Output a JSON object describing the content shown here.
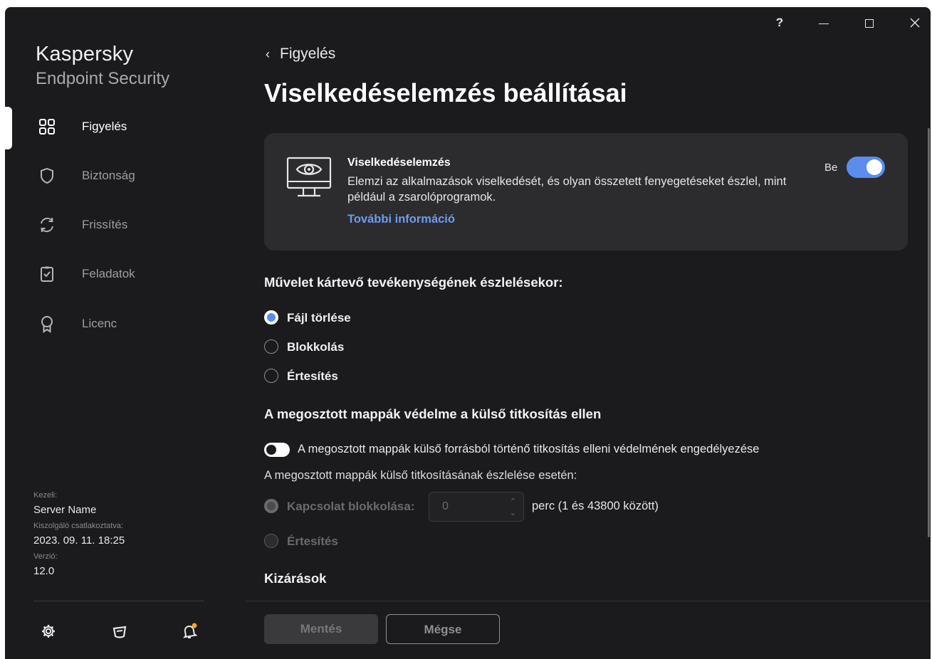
{
  "window": {
    "controls": {
      "help": "?"
    }
  },
  "brand": {
    "line1": "Kaspersky",
    "line2": "Endpoint Security"
  },
  "sidebar": {
    "items": [
      {
        "label": "Figyelés",
        "icon": "grid-icon",
        "active": true
      },
      {
        "label": "Biztonság",
        "icon": "shield-icon",
        "active": false
      },
      {
        "label": "Frissítés",
        "icon": "refresh-icon",
        "active": false
      },
      {
        "label": "Feladatok",
        "icon": "clipboard-check-icon",
        "active": false
      },
      {
        "label": "Licenc",
        "icon": "award-icon",
        "active": false
      }
    ],
    "meta": {
      "managed_label": "Kezeli:",
      "server_name": "Server Name",
      "connected_label": "Kiszolgáló csatlakoztatva:",
      "connected_time": "2023. 09. 11. 18:25",
      "version_label": "Verzió:",
      "version": "12.0"
    },
    "bottom_icons": [
      "gear-icon",
      "support-icon",
      "bell-icon"
    ]
  },
  "main": {
    "back_label": "Figyelés",
    "title": "Viselkedéselemzés beállításai",
    "card": {
      "title": "Viselkedéselemzés",
      "description": "Elemzi az alkalmazások viselkedését, és olyan összetett fenyegetéseket észlel, mint például a zsarolóprogramok.",
      "link": "További információ",
      "toggle_label": "Be",
      "toggle_on": true
    },
    "action_heading": "Művelet kártevő tevékenységének észlelésekor:",
    "action_options": [
      "Fájl törlése",
      "Blokkolás",
      "Értesítés"
    ],
    "action_selected": "Fájl törlése",
    "shared_heading": "A megosztott mappák védelme a külső titkosítás ellen",
    "shared_toggle_label": "A megosztott mappák külső forrásból történő titkosítás elleni védelmének engedélyezése",
    "shared_toggle_on": false,
    "shared_detect_label": "A megosztott mappák külső titkosításának észlelése esetén:",
    "block_label": "Kapcsolat blokkolása:",
    "block_value": "0",
    "block_range": "perc (1 és 43800 között)",
    "notify_label": "Értesítés",
    "exclusions_heading": "Kizárások"
  },
  "footer": {
    "save_label": "Mentés",
    "cancel_label": "Mégse"
  },
  "colors": {
    "accent": "#5a8dee",
    "link": "#6c9cf0",
    "background": "#1b1b1d",
    "card": "#2c2c2f"
  }
}
